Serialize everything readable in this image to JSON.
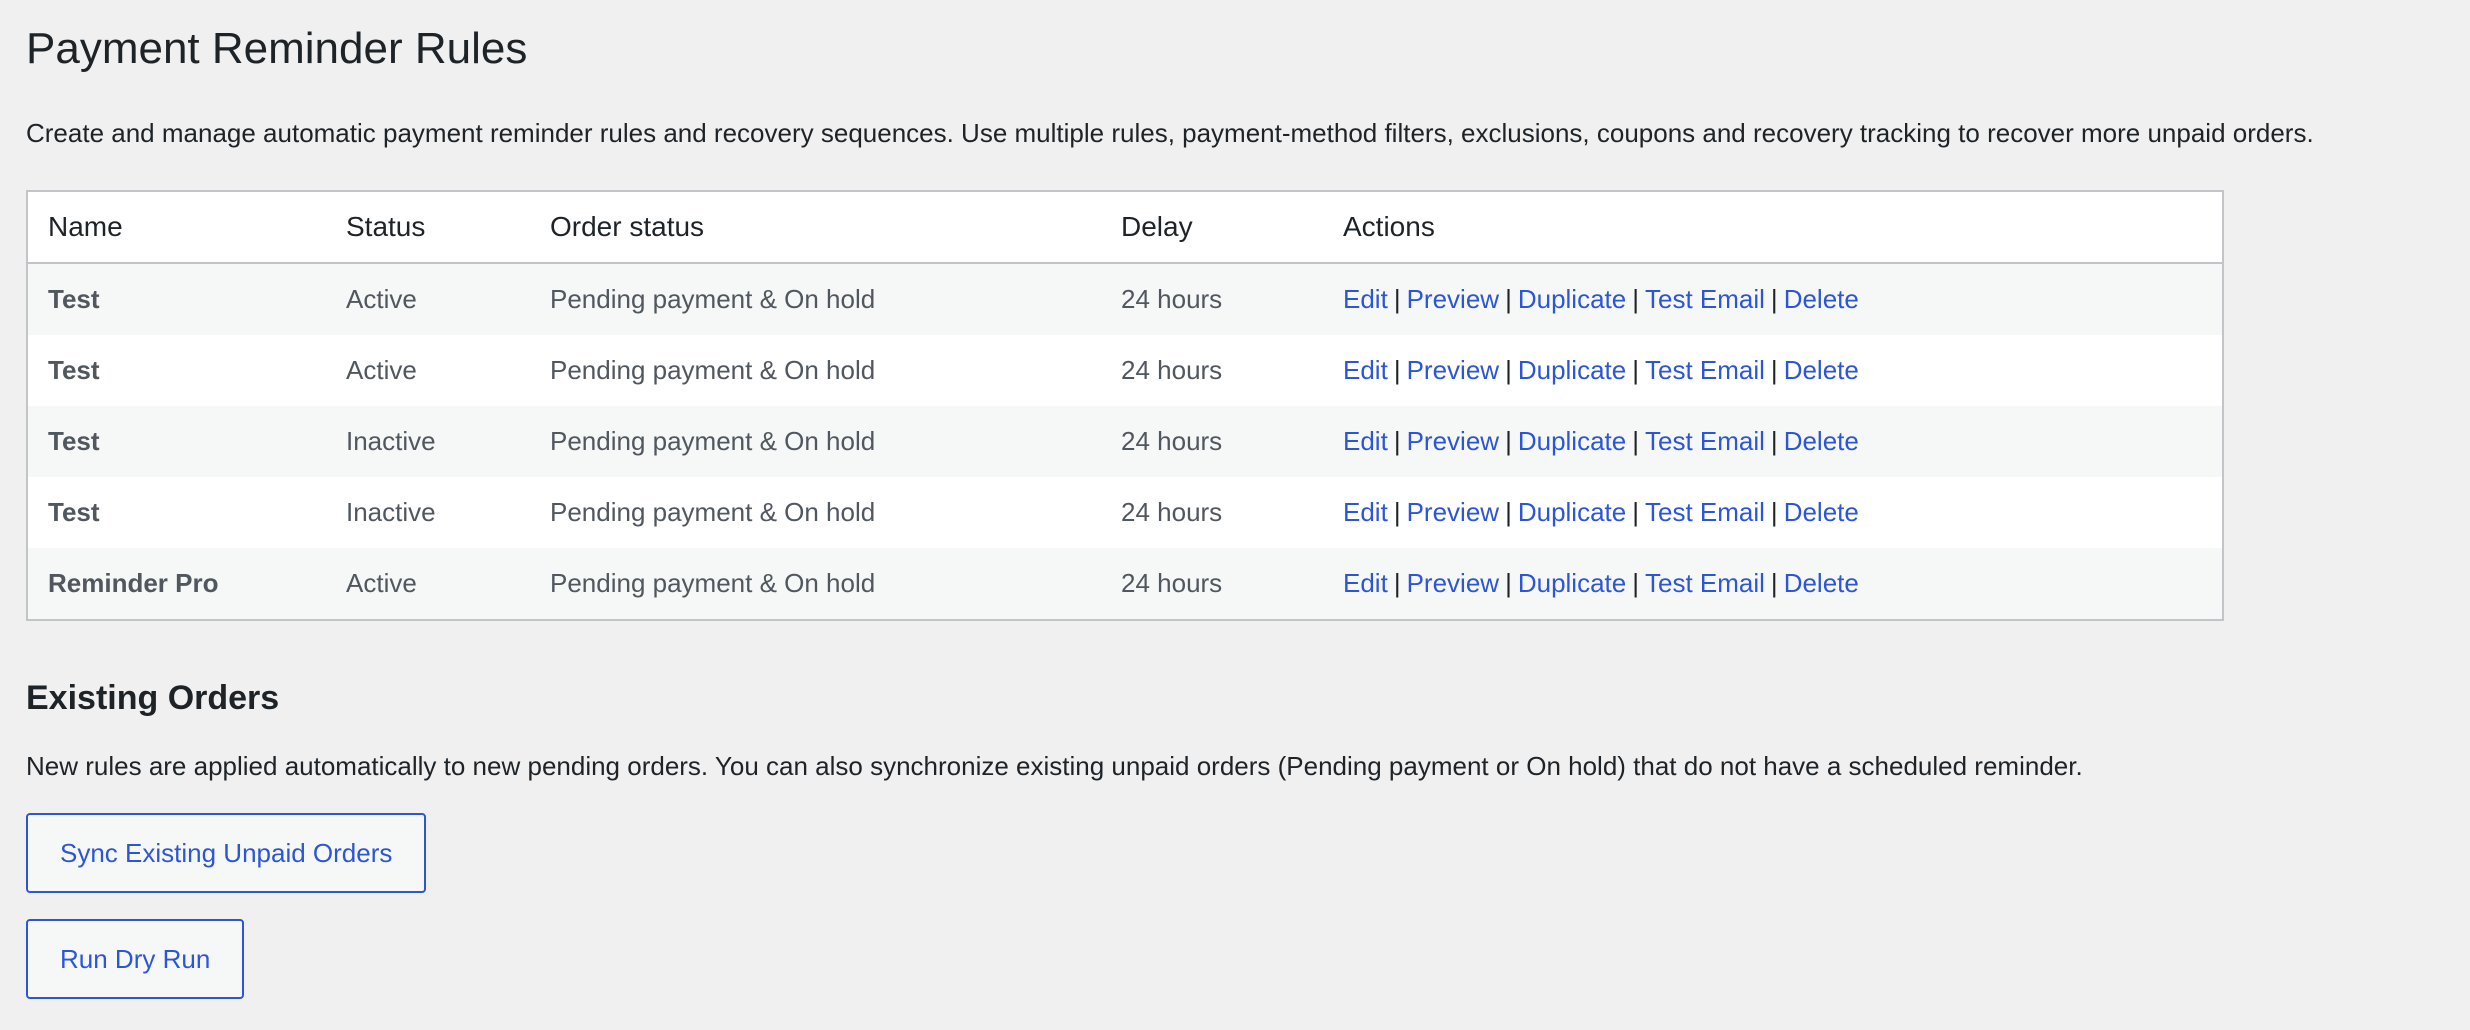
{
  "page": {
    "title": "Payment Reminder Rules",
    "intro": "Create and manage automatic payment reminder rules and recovery sequences. Use multiple rules, payment-method filters, exclusions, coupons and recovery tracking to recover more unpaid orders."
  },
  "table": {
    "headers": {
      "name": "Name",
      "status": "Status",
      "order_status": "Order status",
      "delay": "Delay",
      "actions": "Actions"
    },
    "rows": [
      {
        "name": "Test",
        "status": "Active",
        "order_status": "Pending payment & On hold",
        "delay": "24 hours"
      },
      {
        "name": "Test",
        "status": "Active",
        "order_status": "Pending payment & On hold",
        "delay": "24 hours"
      },
      {
        "name": "Test",
        "status": "Inactive",
        "order_status": "Pending payment & On hold",
        "delay": "24 hours"
      },
      {
        "name": "Test",
        "status": "Inactive",
        "order_status": "Pending payment & On hold",
        "delay": "24 hours"
      },
      {
        "name": "Reminder Pro",
        "status": "Active",
        "order_status": "Pending payment & On hold",
        "delay": "24 hours"
      }
    ],
    "actions": {
      "edit": "Edit",
      "preview": "Preview",
      "duplicate": "Duplicate",
      "test_email": "Test Email",
      "delete": "Delete",
      "separator": "|"
    }
  },
  "existing_orders": {
    "title": "Existing Orders",
    "description": "New rules are applied automatically to new pending orders. You can also synchronize existing unpaid orders (Pending payment or On hold) that do not have a scheduled reminder.",
    "sync_button": "Sync Existing Unpaid Orders",
    "dry_run_button": "Run Dry Run"
  },
  "colors": {
    "link": "#2c56d6",
    "background": "#f0f0f1",
    "border": "#c3c4c7"
  }
}
